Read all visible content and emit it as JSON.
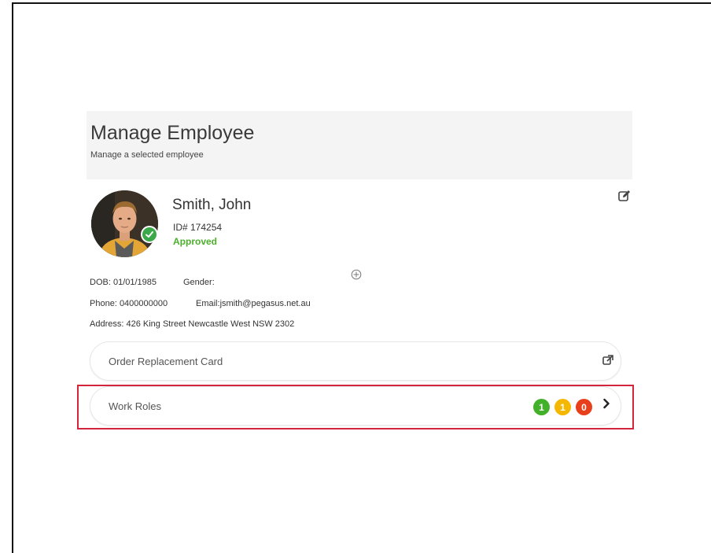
{
  "header": {
    "title": "Manage Employee",
    "subtitle": "Manage a selected employee"
  },
  "employee": {
    "name": "Smith, John",
    "id_text": "ID# 174254",
    "status": "Approved",
    "dob_label": "DOB:",
    "dob": "01/01/1985",
    "gender_label": "Gender:",
    "gender": "",
    "phone_label": "Phone:",
    "phone": "0400000000",
    "email_label": "Email:",
    "email": "jsmith@pegasus.net.au",
    "address_label": "Address:",
    "address": "426 King Street Newcastle West NSW 2302"
  },
  "actions": {
    "order_card_label": "Order Replacement Card",
    "work_roles_label": "Work Roles"
  },
  "work_role_counts": [
    {
      "value": "1",
      "color": "#43b02a"
    },
    {
      "value": "1",
      "color": "#f5b800"
    },
    {
      "value": "0",
      "color": "#e8401c"
    }
  ],
  "icons": {
    "edit": "edit-icon",
    "add": "add-circle-icon",
    "external": "external-link-icon",
    "chevron": "chevron-right-icon",
    "approved": "check-icon"
  },
  "colors": {
    "status_green": "#4caf2a",
    "highlight_red": "#d2243a",
    "header_bg": "#f4f4f4"
  }
}
